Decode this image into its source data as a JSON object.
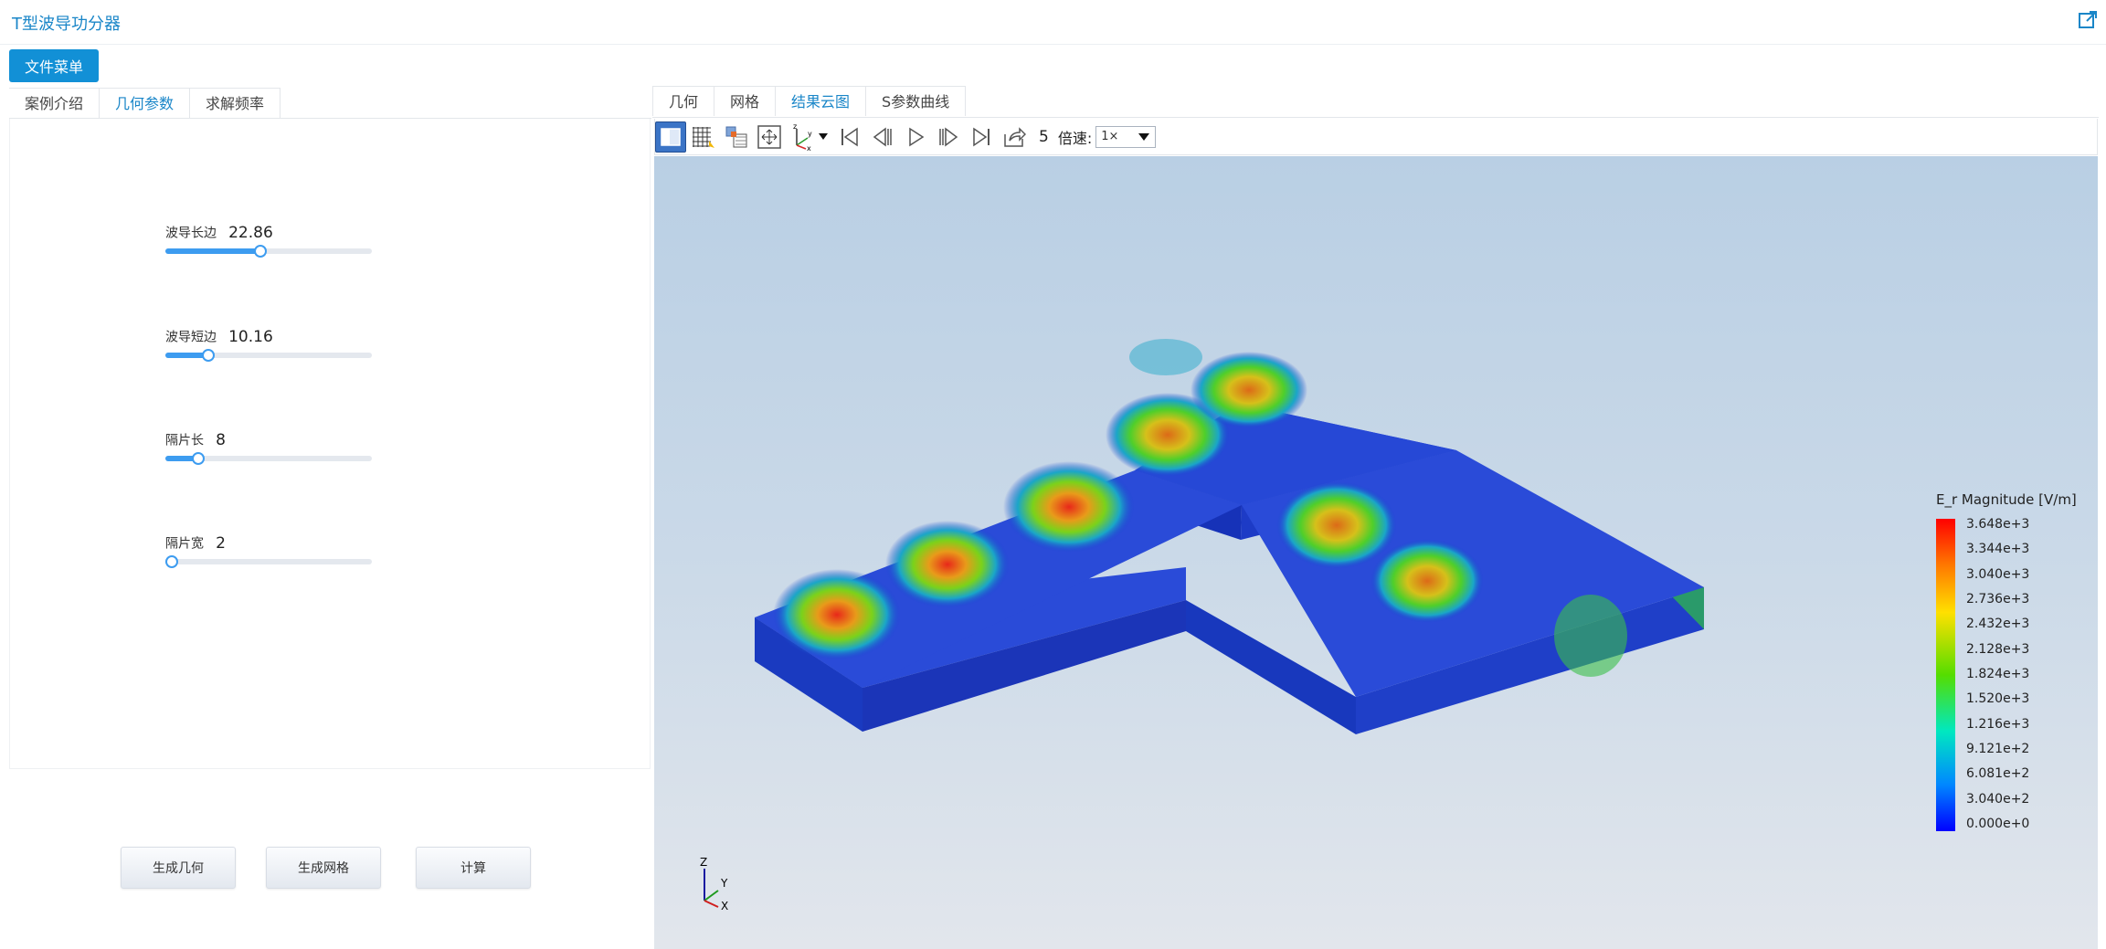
{
  "app": {
    "title": "T型波导功分器"
  },
  "file_menu": {
    "label": "文件菜单"
  },
  "left_tabs": [
    {
      "label": "案例介绍",
      "active": false
    },
    {
      "label": "几何参数",
      "active": true
    },
    {
      "label": "求解频率",
      "active": false
    }
  ],
  "params": [
    {
      "label": "波导长边",
      "value": "22.86",
      "fraction": 0.46
    },
    {
      "label": "波导短边",
      "value": "10.16",
      "fraction": 0.21
    },
    {
      "label": "隔片长",
      "value": "8",
      "fraction": 0.16
    },
    {
      "label": "隔片宽",
      "value": "2",
      "fraction": 0.03
    }
  ],
  "actions": {
    "generate_geometry": "生成几何",
    "generate_mesh": "生成网格",
    "compute": "计算"
  },
  "right_tabs": [
    {
      "label": "几何",
      "active": false
    },
    {
      "label": "网格",
      "active": false
    },
    {
      "label": "结果云图",
      "active": true
    },
    {
      "label": "S参数曲线",
      "active": false
    }
  ],
  "toolbar": {
    "frame": "5",
    "speed_label": "倍速:",
    "speed_value": "1×"
  },
  "axes": {
    "z": "Z",
    "y": "Y",
    "x": "X"
  },
  "legend": {
    "title": "E_r Magnitude [V/m]",
    "ticks": [
      "3.648e+3",
      "3.344e+3",
      "3.040e+3",
      "2.736e+3",
      "2.432e+3",
      "2.128e+3",
      "1.824e+3",
      "1.520e+3",
      "1.216e+3",
      "9.121e+2",
      "6.081e+2",
      "3.040e+2",
      "0.000e+0"
    ],
    "colors": {
      "max": "#ff0000",
      "mid": "#55dd00",
      "min": "#0000ff"
    }
  },
  "colors": {
    "accent": "#1a86c8",
    "button": "#1290d6",
    "slider": "#3d9cf0"
  }
}
